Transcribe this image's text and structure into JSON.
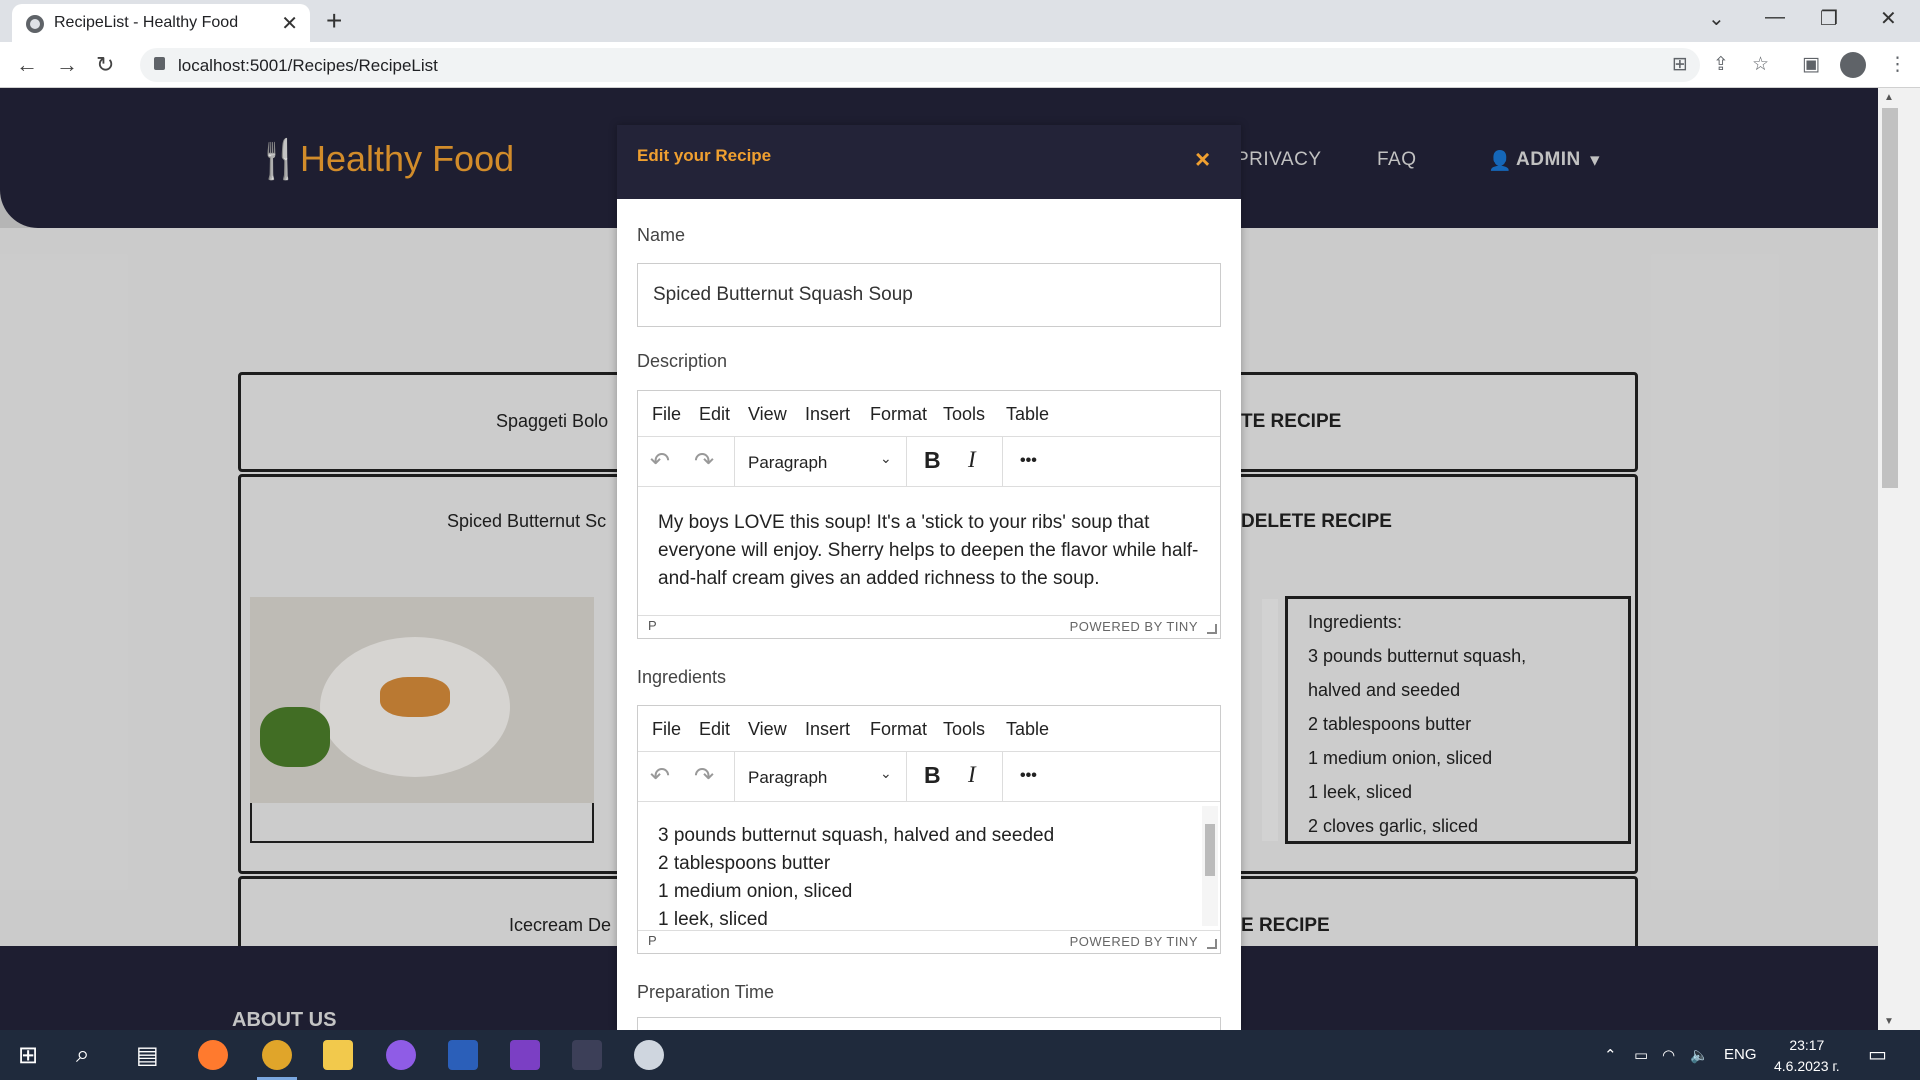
{
  "browser": {
    "tab_title": "RecipeList - Healthy Food",
    "tab_close": "✕",
    "new_tab": "+",
    "url": "localhost:5001/Recipes/RecipeList",
    "win_minimize": "—",
    "win_restore": "❐",
    "win_close": "✕",
    "win_dropdown": "⌄"
  },
  "site": {
    "logo_icon": "utensils-icon",
    "logo_text": "Healthy Food",
    "nav": [
      "PRIVACY",
      "FAQ"
    ],
    "admin_label": "ADMIN",
    "admin_caret": "▾"
  },
  "recipes": [
    {
      "name": "Spaggeti Bolo",
      "action": "TE RECIPE"
    },
    {
      "name": "Spiced Butternut Sc",
      "action": "DELETE RECIPE"
    },
    {
      "name": "Icecream De",
      "action": "E RECIPE"
    }
  ],
  "ingredients_panel": {
    "title": "Ingredients:",
    "lines": [
      "3 pounds butternut squash,",
      "halved and seeded",
      "2 tablespoons butter",
      "1 medium onion, sliced",
      "1 leek, sliced",
      "2 cloves garlic, sliced"
    ]
  },
  "footer": {
    "title": "ABOUT US"
  },
  "modal": {
    "title": "Edit your Recipe",
    "close": "×",
    "name_label": "Name",
    "name_value": "Spiced Butternut Squash Soup",
    "description_label": "Description",
    "ingredients_label": "Ingredients",
    "prep_label": "Preparation Time",
    "menu": [
      "File",
      "Edit",
      "View",
      "Insert",
      "Format",
      "Tools",
      "Table"
    ],
    "block_format": "Paragraph",
    "bold": "B",
    "italic": "I",
    "more": "•••",
    "undo": "↶",
    "redo": "↷",
    "status_path": "P",
    "status_brand": "POWERED BY TINY",
    "description_text": "My boys LOVE this soup! It's a 'stick to your ribs' soup that everyone will enjoy. Sherry helps to deepen the flavor while half-and-half cream gives an added richness to the soup.",
    "ingredients_lines": [
      "3 pounds butternut squash, halved and seeded",
      "2 tablespoons butter",
      "1 medium onion, sliced",
      "1 leek, sliced"
    ]
  },
  "taskbar": {
    "lang": "ENG",
    "time": "23:17",
    "date": "4.6.2023 г."
  }
}
